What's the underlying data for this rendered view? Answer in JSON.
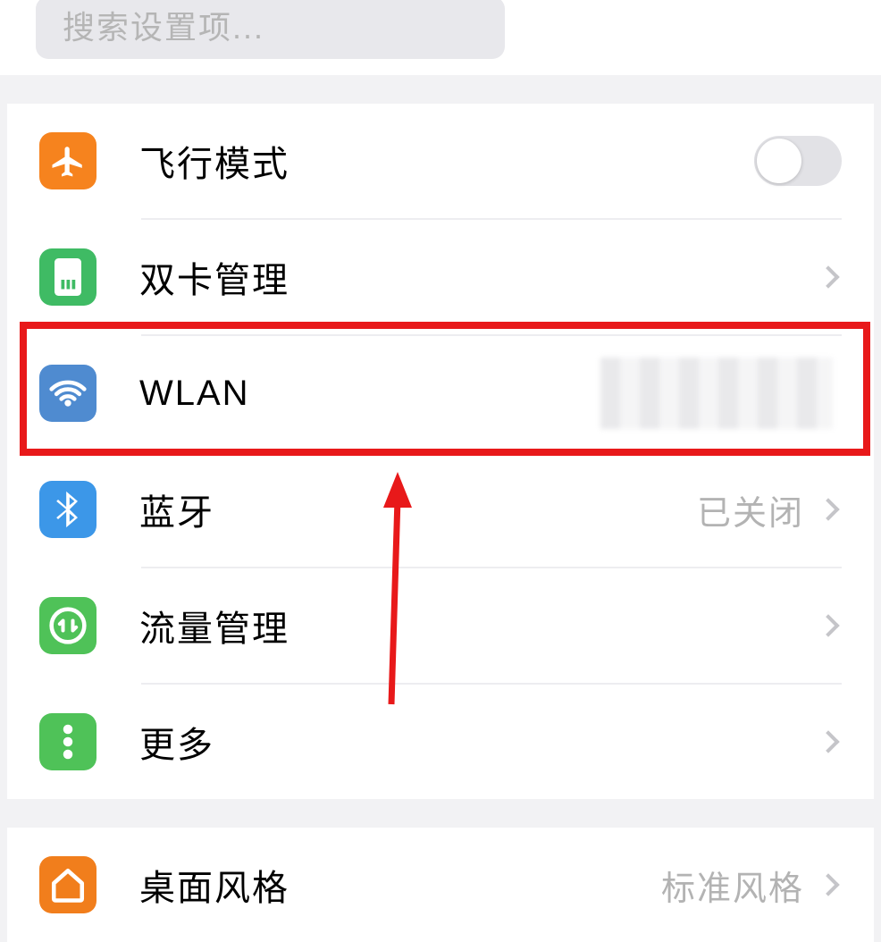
{
  "search": {
    "placeholder": "搜索设置项..."
  },
  "group1": {
    "airplane": {
      "label": "飞行模式",
      "on": false
    },
    "sim": {
      "label": "双卡管理"
    },
    "wlan": {
      "label": "WLAN",
      "value": ""
    },
    "bluetooth": {
      "label": "蓝牙",
      "value": "已关闭"
    },
    "data": {
      "label": "流量管理"
    },
    "more": {
      "label": "更多"
    }
  },
  "group2": {
    "home": {
      "label": "桌面风格",
      "value": "标准风格"
    }
  },
  "annotation": {
    "highlight": "wlan",
    "arrow_color": "#e8191a"
  }
}
